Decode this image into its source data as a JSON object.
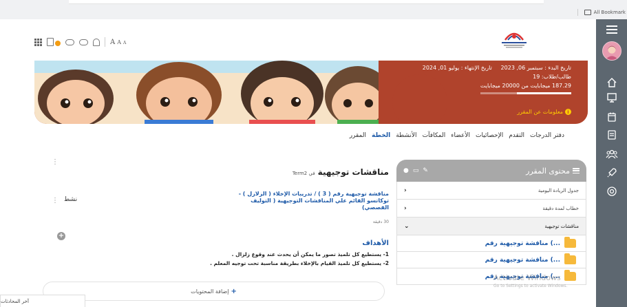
{
  "browser": {
    "bookmarks_label": "All Bookmark"
  },
  "header": {
    "font_sizes": [
      "A",
      "A",
      "A"
    ],
    "logo_text": "EGYPTIAN JAPANESE SCHOOLS"
  },
  "banner": {
    "start_label": "تاريخ البدء : سبتمبر 06, 2023",
    "end_label": "تاريخ الإنتهاء : يوليو 01, 2024",
    "students_label": "طالب/طلاب: 19",
    "storage_label": "187.29 ميجابايت من 20000 ميجابايت",
    "storage_used_fraction": 0.0094,
    "info_link": "معلومات عن المقرر"
  },
  "tabs": [
    {
      "label": "المقرر",
      "active": false
    },
    {
      "label": "الخطة",
      "active": true
    },
    {
      "label": "الأنشطة",
      "active": false
    },
    {
      "label": "المكافآت",
      "active": false
    },
    {
      "label": "الأعضاء",
      "active": false
    },
    {
      "label": "الإحصائيات",
      "active": false
    },
    {
      "label": "التقدم",
      "active": false
    },
    {
      "label": "دفتر الدرجات",
      "active": false
    }
  ],
  "lesson": {
    "title": "مناقشات توجيهية",
    "term": "في Term2",
    "status": "نشط",
    "activity_title": "مناقشة توجيهية رقم ( 3 ) / تدريبات الإخلاء ( الزلازل ) - توكاتسو القائم علي المناقشات التوجيهية ( التوليف القصصي)",
    "duration": "30 دقيقة",
    "goals_title": "الأهداف",
    "goals": [
      "1- يستطيع كل تلميذ تصور ما يمكن أن يحدث عند وقوع زلزال .",
      "2- يستطيع كل تلميذ القيام بالإخلاء بطريقة مناسبة تحت توجيه المعلم ."
    ],
    "add_content": "إضافة المحتويات"
  },
  "panel": {
    "title": "محتوى المقرر",
    "rows": [
      {
        "label": "جدول الريادة اليومية"
      },
      {
        "label": "خطاب لمدة دقيقة"
      },
      {
        "label": "مناقشات توجيهية"
      }
    ],
    "sub_items": [
      "مناقشة توجيهية رقم (...",
      "مناقشة توجيهية رقم (...",
      "مناقشة توجيهية رقم (..."
    ]
  },
  "watermark": {
    "line1": "Activate Windows",
    "line2": "Go to Settings to activate Windows."
  },
  "bottom": {
    "recent_chats": "آخر المحادثات"
  },
  "colors": {
    "accent": "#1e5aa8",
    "sidebar": "#5d6770",
    "banner": "#c44a33",
    "panel_head": "#a8a8a8"
  }
}
